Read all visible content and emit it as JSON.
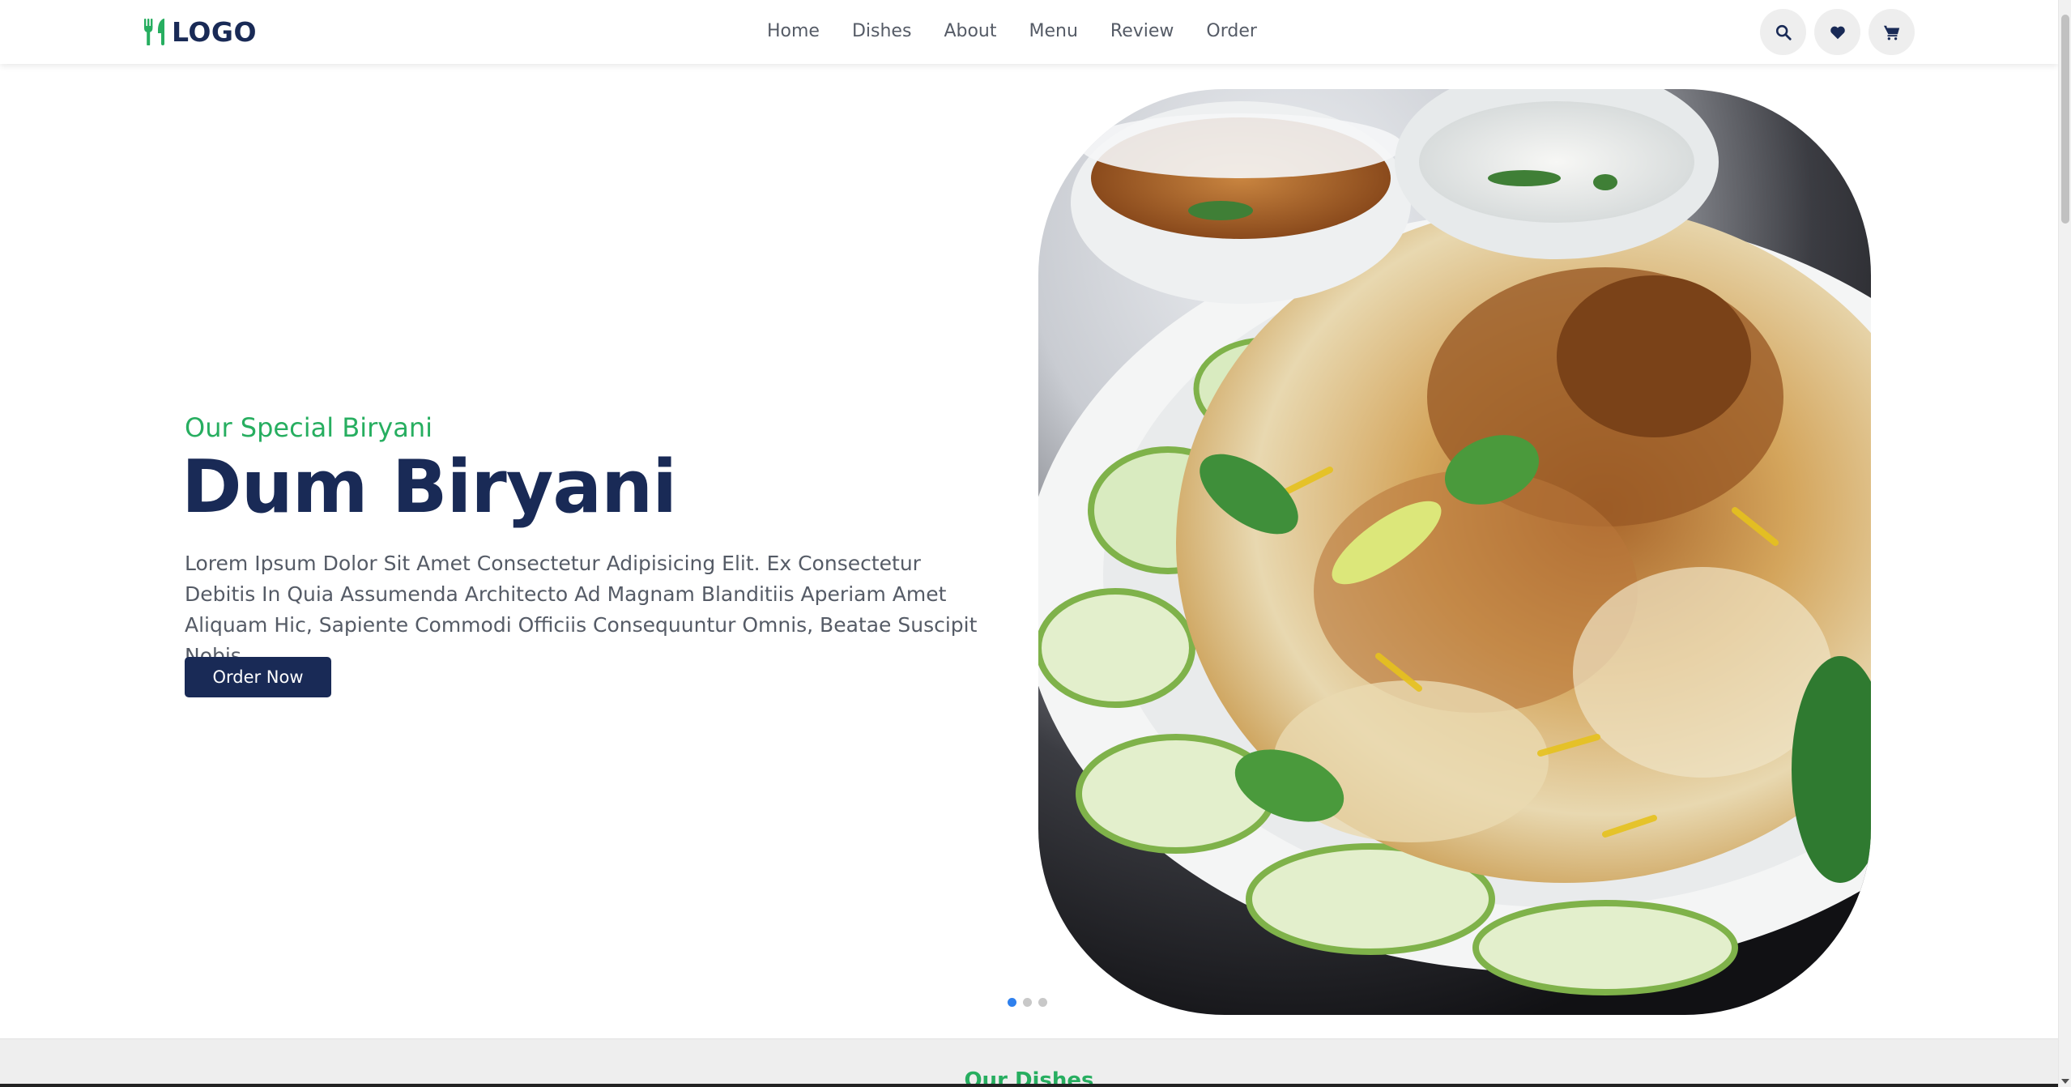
{
  "logo": {
    "text": "LOGO",
    "icon": "utensils-icon",
    "accent": "#27ae60"
  },
  "nav": {
    "items": [
      {
        "label": "Home"
      },
      {
        "label": "Dishes"
      },
      {
        "label": "About"
      },
      {
        "label": "Menu"
      },
      {
        "label": "Review"
      },
      {
        "label": "Order"
      }
    ]
  },
  "header_icons": [
    "search-icon",
    "heart-icon",
    "cart-icon"
  ],
  "hero": {
    "subtitle": "Our Special Biryani",
    "title": "Dum Biryani",
    "description": "Lorem Ipsum Dolor Sit Amet Consectetur Adipisicing Elit. Ex Consectetur Debitis In Quia Assumenda Architecto Ad Magnam Blanditiis Aperiam Amet Aliquam Hic, Sapiente Commodi Officiis Consequuntur Omnis, Beatae Suscipit Nobis.",
    "button_label": "Order Now",
    "slides": {
      "count": 3,
      "active": 1
    }
  },
  "dishes_section": {
    "subtitle": "Our Dishes"
  },
  "colors": {
    "primary": "#192a56",
    "accent": "#27ae60",
    "text": "#555b66",
    "active_dot": "#2f80ed"
  }
}
